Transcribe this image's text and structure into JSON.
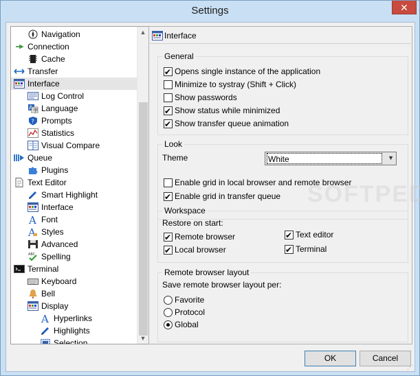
{
  "window": {
    "title": "Settings",
    "close_glyph": "✕"
  },
  "tree": {
    "items": [
      {
        "label": "Navigation",
        "icon": "compass-icon",
        "level": 1
      },
      {
        "label": "Connection",
        "icon": "plug-icon",
        "level": 0
      },
      {
        "label": "Cache",
        "icon": "chip-icon",
        "level": 1
      },
      {
        "label": "Transfer",
        "icon": "transfer-arrows-icon",
        "level": 0
      },
      {
        "label": "Interface",
        "icon": "window-icon",
        "level": 0,
        "selected": true
      },
      {
        "label": "Log Control",
        "icon": "log-icon",
        "level": 1
      },
      {
        "label": "Language",
        "icon": "language-icon",
        "level": 1
      },
      {
        "label": "Prompts",
        "icon": "shield-question-icon",
        "level": 1
      },
      {
        "label": "Statistics",
        "icon": "chart-icon",
        "level": 1
      },
      {
        "label": "Visual Compare",
        "icon": "compare-icon",
        "level": 1
      },
      {
        "label": "Queue",
        "icon": "queue-icon",
        "level": 0
      },
      {
        "label": "Plugins",
        "icon": "puzzle-icon",
        "level": 1
      },
      {
        "label": "Text Editor",
        "icon": "document-icon",
        "level": 0
      },
      {
        "label": "Smart Highlight",
        "icon": "pen-icon",
        "level": 1
      },
      {
        "label": "Interface",
        "icon": "window-icon",
        "level": 1
      },
      {
        "label": "Font",
        "icon": "font-icon",
        "level": 1
      },
      {
        "label": "Styles",
        "icon": "styles-icon",
        "level": 1
      },
      {
        "label": "Advanced",
        "icon": "floppy-icon",
        "level": 1
      },
      {
        "label": "Spelling",
        "icon": "spellcheck-icon",
        "level": 1
      },
      {
        "label": "Terminal",
        "icon": "terminal-icon",
        "level": 0
      },
      {
        "label": "Keyboard",
        "icon": "keyboard-icon",
        "level": 1
      },
      {
        "label": "Bell",
        "icon": "bell-icon",
        "level": 1
      },
      {
        "label": "Display",
        "icon": "window-icon",
        "level": 1
      },
      {
        "label": "Hyperlinks",
        "icon": "font-icon",
        "level": 2
      },
      {
        "label": "Highlights",
        "icon": "pen-icon",
        "level": 2
      },
      {
        "label": "Selection",
        "icon": "selection-icon",
        "level": 2
      }
    ]
  },
  "panel": {
    "header": "Interface",
    "general": {
      "title": "General",
      "options": [
        {
          "label": "Opens single instance of the application",
          "checked": true
        },
        {
          "label": "Minimize to systray (Shift + Click)",
          "checked": false
        },
        {
          "label": "Show passwords",
          "checked": false
        },
        {
          "label": "Show status while minimized",
          "checked": true
        },
        {
          "label": "Show transfer queue animation",
          "checked": true
        }
      ]
    },
    "look": {
      "title": "Look",
      "theme_label": "Theme",
      "theme_value": "White",
      "options": [
        {
          "label": "Enable grid in local browser and remote browser",
          "checked": false
        },
        {
          "label": "Enable grid in transfer queue",
          "checked": true
        }
      ]
    },
    "workspace": {
      "title": "Workspace",
      "restore_label": "Restore on start:",
      "options": [
        {
          "label": "Remote browser",
          "checked": true
        },
        {
          "label": "Local browser",
          "checked": true
        },
        {
          "label": "Text editor",
          "checked": true
        },
        {
          "label": "Terminal",
          "checked": true
        }
      ]
    },
    "remote_layout": {
      "title": "Remote browser layout",
      "save_label": "Save remote browser layout per:",
      "options": [
        {
          "label": "Favorite",
          "selected": false
        },
        {
          "label": "Protocol",
          "selected": false
        },
        {
          "label": "Global",
          "selected": true
        }
      ]
    }
  },
  "buttons": {
    "ok": "OK",
    "cancel": "Cancel"
  },
  "watermark": "SOFTPEDIA",
  "colors": {
    "accent": "#3c7fb1",
    "close": "#c74b3e",
    "frame": "#c9dff3"
  }
}
